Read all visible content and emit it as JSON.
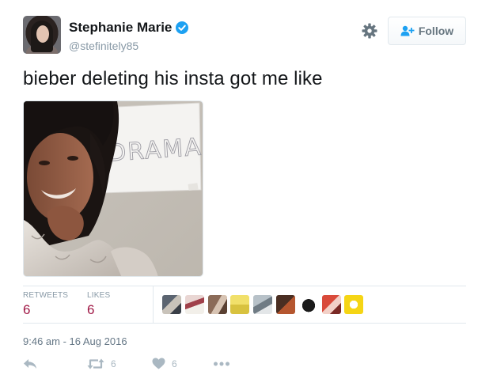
{
  "user": {
    "display_name": "Stephanie Marie",
    "handle": "@stefinitely85",
    "avatar_icon": "profile-photo",
    "verified_icon": "verified-badge-icon",
    "verified_color": "#1da1f2"
  },
  "header": {
    "settings_icon": "gear-icon",
    "follow_label": "Follow",
    "follow_icon": "add-user-icon"
  },
  "tweet": {
    "text": "bieber deleting his insta got me like",
    "media_sign_text": "DRAMA"
  },
  "stats": {
    "retweets_label": "RETWEETS",
    "retweets_value": "6",
    "likes_label": "LIKES",
    "likes_value": "6",
    "value_color": "#a01845"
  },
  "likers": [
    {
      "name": "liker-avatar-1"
    },
    {
      "name": "liker-avatar-2"
    },
    {
      "name": "liker-avatar-3"
    },
    {
      "name": "liker-avatar-4"
    },
    {
      "name": "liker-avatar-5"
    },
    {
      "name": "liker-avatar-6"
    },
    {
      "name": "liker-avatar-7"
    },
    {
      "name": "liker-avatar-8"
    },
    {
      "name": "liker-avatar-9"
    }
  ],
  "timestamp": "9:46 am - 16 Aug 2016",
  "actions": {
    "reply_icon": "reply-icon",
    "retweet_icon": "retweet-icon",
    "retweet_count": "6",
    "like_icon": "heart-icon",
    "like_count": "6",
    "more_icon": "more-dots-icon"
  }
}
